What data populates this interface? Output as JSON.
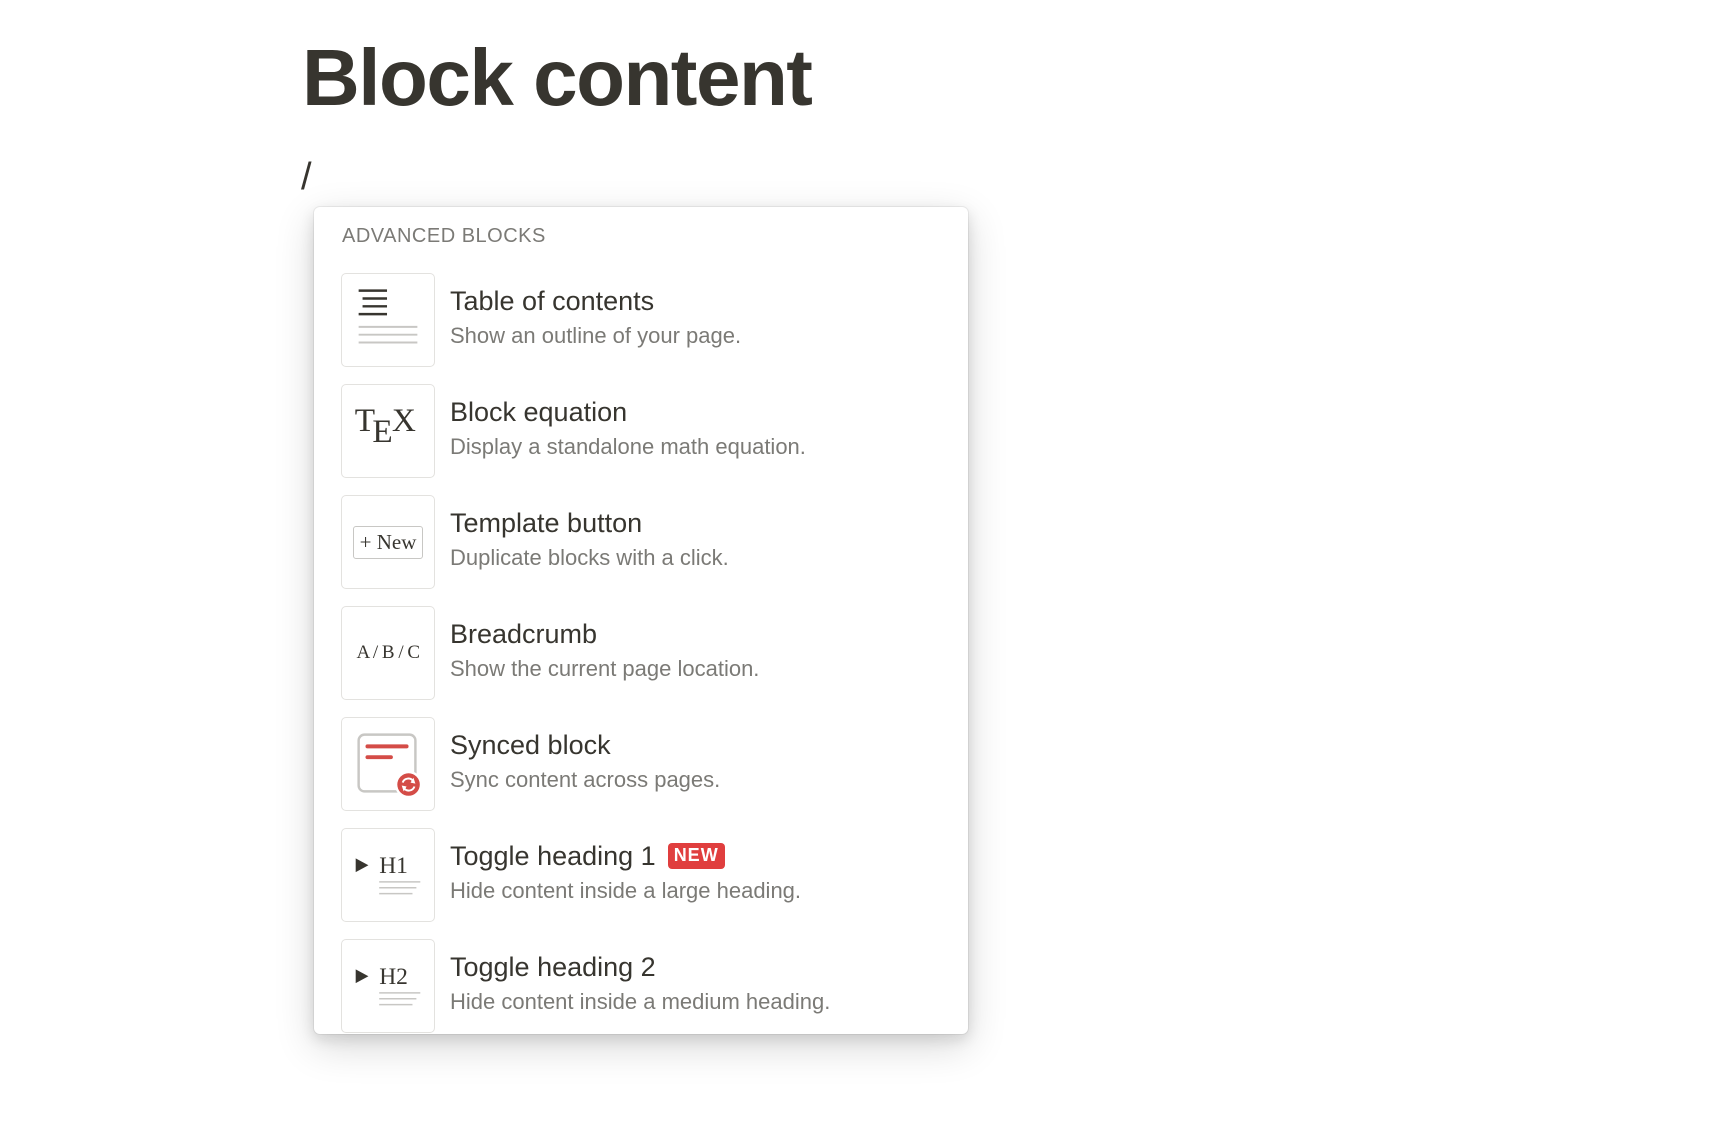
{
  "page": {
    "title": "Block content",
    "input_text": "/"
  },
  "menu": {
    "section_title": "ADVANCED BLOCKS",
    "items": [
      {
        "title": "Table of contents",
        "description": "Show an outline of your page.",
        "icon": "table-of-contents-icon"
      },
      {
        "title": "Block equation",
        "description": "Display a standalone math equation.",
        "icon": "tex-equation-icon",
        "icon_text": "TEX"
      },
      {
        "title": "Template button",
        "description": "Duplicate blocks with a click.",
        "icon": "template-button-icon",
        "icon_text": "+ New"
      },
      {
        "title": "Breadcrumb",
        "description": "Show the current page location.",
        "icon": "breadcrumb-icon",
        "icon_text": "A / B / C"
      },
      {
        "title": "Synced block",
        "description": "Sync content across pages.",
        "icon": "synced-block-icon"
      },
      {
        "title": "Toggle heading 1",
        "description": "Hide content inside a large heading.",
        "icon": "toggle-heading-1-icon",
        "icon_text": "H1",
        "badge": "NEW"
      },
      {
        "title": "Toggle heading 2",
        "description": "Hide content inside a medium heading.",
        "icon": "toggle-heading-2-icon",
        "icon_text": "H2"
      }
    ]
  },
  "colors": {
    "text": "#37352f",
    "secondary_text": "#7b7a76",
    "badge": "#e03e3e",
    "synced_accent": "#d44c47"
  }
}
